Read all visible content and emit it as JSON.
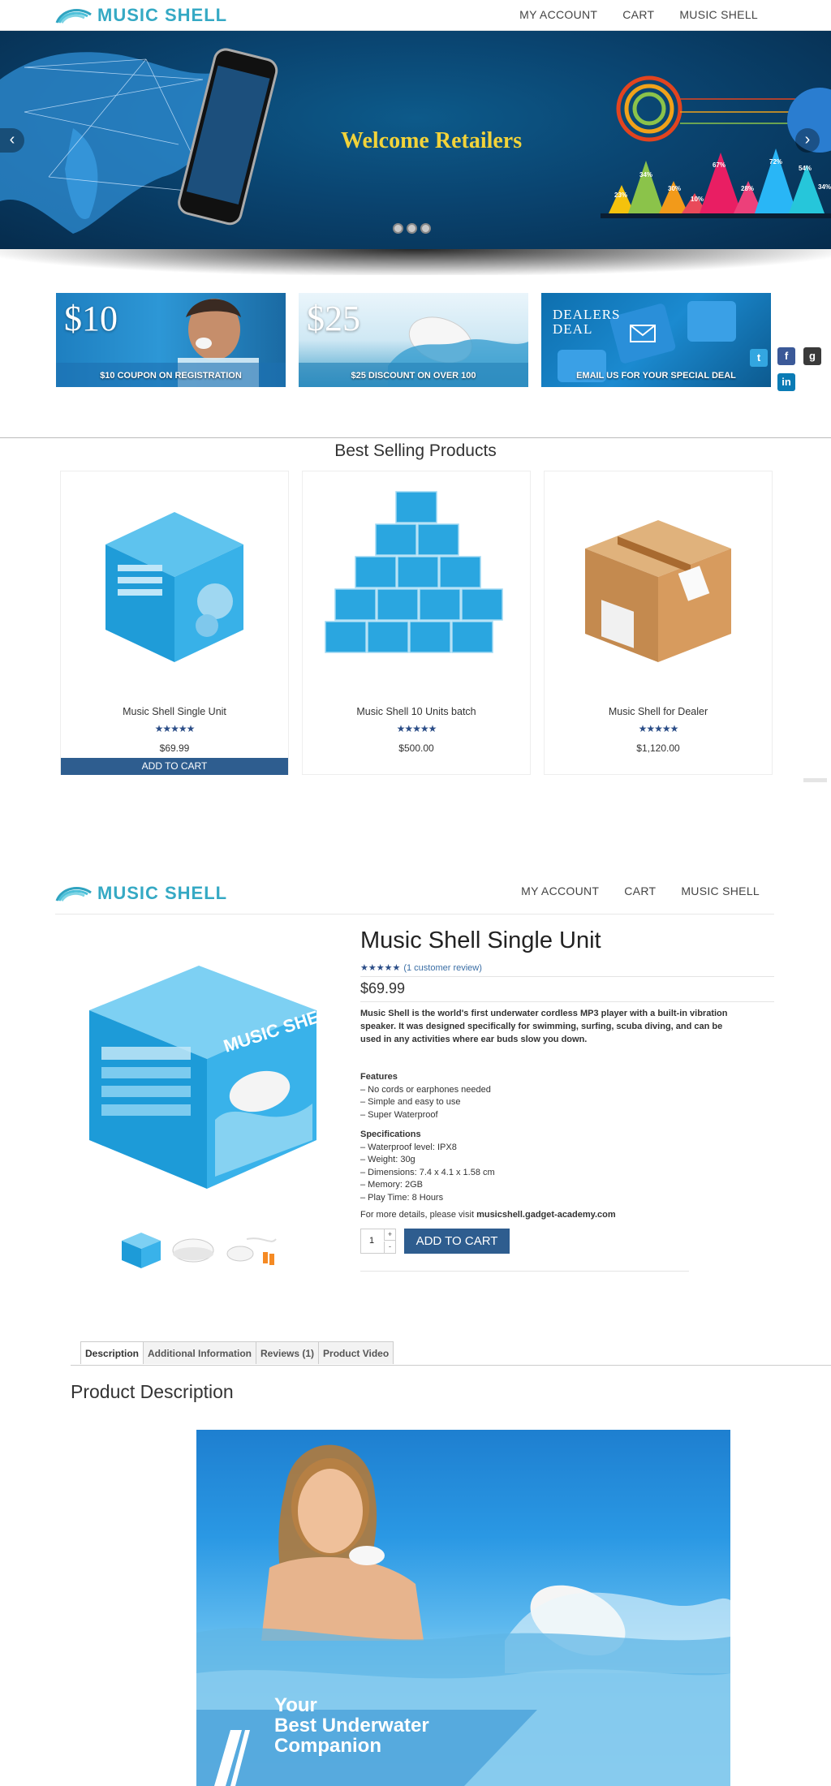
{
  "header": {
    "logo_text": "MUSIC SHELL",
    "nav": [
      "MY ACCOUNT",
      "CART",
      "MUSIC SHELL"
    ]
  },
  "hero": {
    "title": "Welcome Retailers",
    "chart_labels": [
      "23%",
      "34%",
      "30%",
      "10%",
      "67%",
      "28%",
      "72%",
      "54%",
      "34%"
    ],
    "slide_count": 3
  },
  "promos": [
    {
      "amount": "$10",
      "caption": "$10 COUPON ON REGISTRATION"
    },
    {
      "amount": "$25",
      "caption": "$25 DISCOUNT ON OVER 100"
    },
    {
      "amount": "DEALERS\nDEAL",
      "caption": "EMAIL US FOR YOUR SPECIAL DEAL"
    }
  ],
  "best_selling": {
    "title": "Best Selling Products",
    "products": [
      {
        "name": "Music Shell Single Unit",
        "stars": "★★★★★",
        "price": "$69.99",
        "button": "ADD TO CART"
      },
      {
        "name": "Music Shell 10 Units batch",
        "stars": "★★★★★",
        "price": "$500.00"
      },
      {
        "name": "Music Shell for Dealer",
        "stars": "★★★★★",
        "price": "$1,120.00"
      }
    ]
  },
  "product": {
    "title": "Music Shell Single Unit",
    "stars": "★★★★★",
    "review_link": "(1 customer review)",
    "price": "$69.99",
    "description": "Music Shell is the world's first underwater cordless MP3 player with a built-in vibration speaker. It was designed specifically for swimming, surfing, scuba diving, and can be used in any activities where ear buds slow you down.",
    "features_title": "Features",
    "features": [
      "– No cords or earphones needed",
      "– Simple and easy to use",
      "– Super Waterproof"
    ],
    "specs_title": "Specifications",
    "specs": [
      "– Waterproof level: IPX8",
      "– Weight: 30g",
      "– Dimensions: 7.4 x 4.1 x 1.58 cm",
      "– Memory: 2GB",
      "– Play Time: 8 Hours"
    ],
    "more_prefix": "For more details, please visit ",
    "more_link": "musicshell.gadget-academy.com",
    "quantity": "1",
    "add_to_cart": "ADD TO CART",
    "box_label": "MUSIC SHELL"
  },
  "tabs": [
    "Description",
    "Additional Information",
    "Reviews (1)",
    "Product Video"
  ],
  "description_title": "Product Description",
  "banner_tagline": [
    "Your",
    "Best Underwater",
    "Companion"
  ],
  "colors": {
    "brand_teal": "#35a9c4",
    "button_blue": "#2e5d8f",
    "star_blue": "#2b4d87",
    "hero_title": "#f2d33a"
  }
}
